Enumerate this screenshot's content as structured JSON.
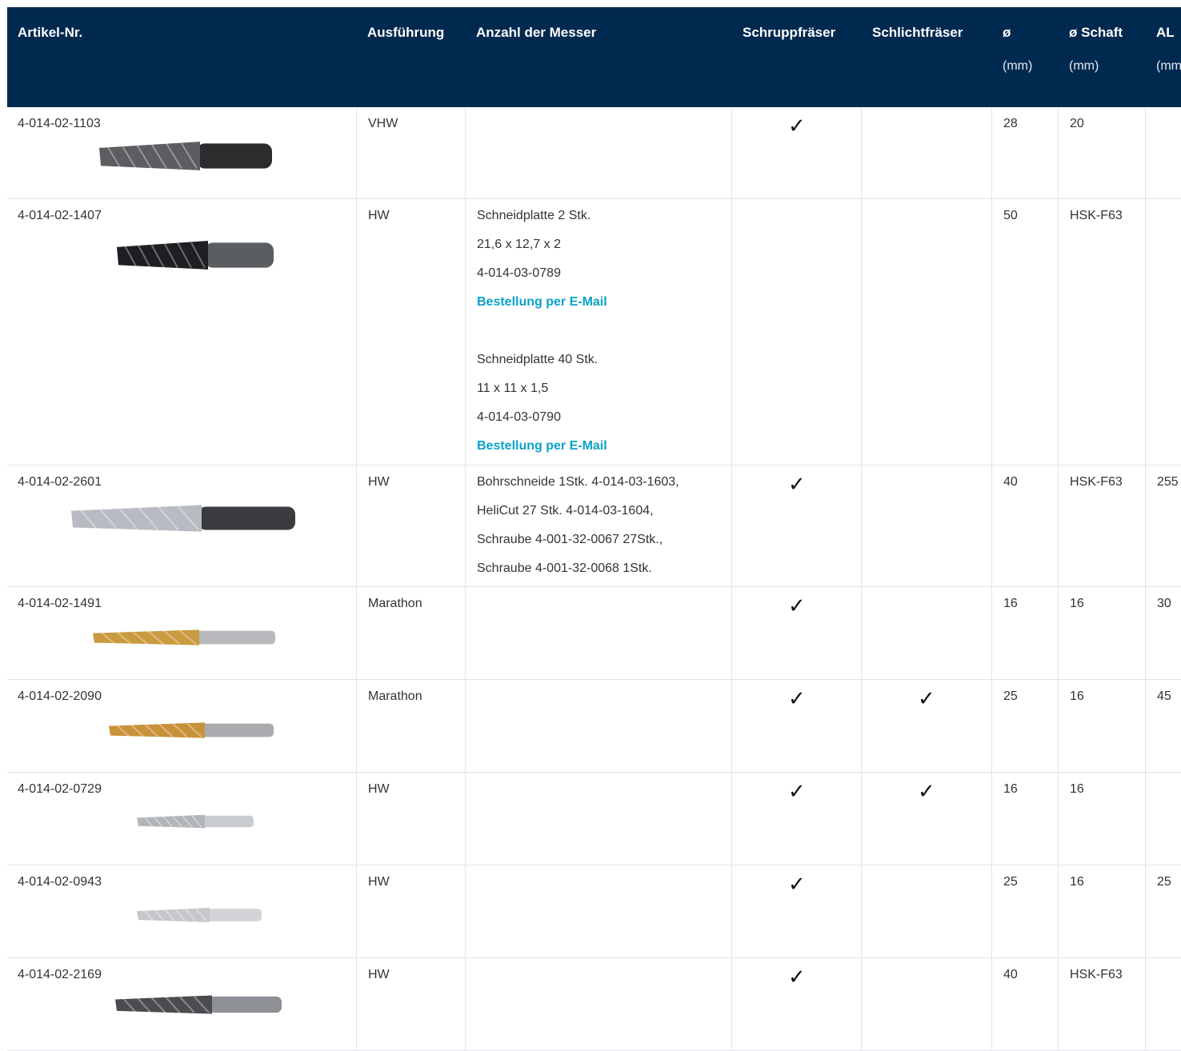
{
  "columns": {
    "artikel": "Artikel-Nr.",
    "ausfuehrung": "Ausführung",
    "messer": "Anzahl der Messer",
    "schrupp": "Schruppfräser",
    "schlicht": "Schlichtfräser",
    "dia": "ø",
    "dia_unit": "(mm)",
    "schaft": "ø Schaft",
    "schaft_unit": "(mm)",
    "al": "AL",
    "al_unit": "(mm"
  },
  "check_symbol": "✓",
  "rows": [
    {
      "artikel": "4-014-02-1103",
      "ausfuehrung": "VHW",
      "messer": [],
      "schrupp": true,
      "schlicht": false,
      "dia": "28",
      "schaft": "20",
      "al": "",
      "image": "vhw-roughing-end-mill-dark"
    },
    {
      "artikel": "4-014-02-1407",
      "ausfuehrung": "HW",
      "messer": [
        "Schneidplatte 2 Stk.",
        "21,6 x 12,7 x 2",
        "4-014-03-0789",
        "Bestellung per E-Mail",
        "",
        "Schneidplatte 40 Stk.",
        "11 x 11 x 1,5",
        "4-014-03-0790",
        "Bestellung per E-Mail"
      ],
      "schrupp": false,
      "schlicht": false,
      "dia": "50",
      "schaft": "HSK-F63",
      "al": "",
      "image": "insert-cutter-hsk"
    },
    {
      "artikel": "4-014-02-2601",
      "ausfuehrung": "HW",
      "messer": [
        "Bohrschneide 1Stk. 4-014-03-1603,",
        "HeliCut 27 Stk. 4-014-03-1604,",
        "Schraube 4-001-32-0067 27Stk.,",
        "Schraube 4-001-32-0068 1Stk."
      ],
      "schrupp": true,
      "schlicht": false,
      "dia": "40",
      "schaft": "HSK-F63",
      "al": "255",
      "image": "helicut-cutter-hsk"
    },
    {
      "artikel": "4-014-02-1491",
      "ausfuehrung": "Marathon",
      "messer": [],
      "schrupp": true,
      "schlicht": false,
      "dia": "16",
      "schaft": "16",
      "al": "30",
      "image": "marathon-gold-cutter"
    },
    {
      "artikel": "4-014-02-2090",
      "ausfuehrung": "Marathon",
      "messer": [],
      "schrupp": true,
      "schlicht": true,
      "dia": "25",
      "schaft": "16",
      "al": "45",
      "image": "marathon-gold-cutter-short"
    },
    {
      "artikel": "4-014-02-0729",
      "ausfuehrung": "HW",
      "messer": [],
      "schrupp": true,
      "schlicht": true,
      "dia": "16",
      "schaft": "16",
      "al": "",
      "image": "hw-silver-cutter"
    },
    {
      "artikel": "4-014-02-0943",
      "ausfuehrung": "HW",
      "messer": [],
      "schrupp": true,
      "schlicht": false,
      "dia": "25",
      "schaft": "16",
      "al": "25",
      "image": "hw-silver-cutter-light"
    },
    {
      "artikel": "4-014-02-2169",
      "ausfuehrung": "HW",
      "messer": [],
      "schrupp": true,
      "schlicht": false,
      "dia": "40",
      "schaft": "HSK-F63",
      "al": "",
      "image": "hw-cutter-hsk-dark"
    }
  ]
}
